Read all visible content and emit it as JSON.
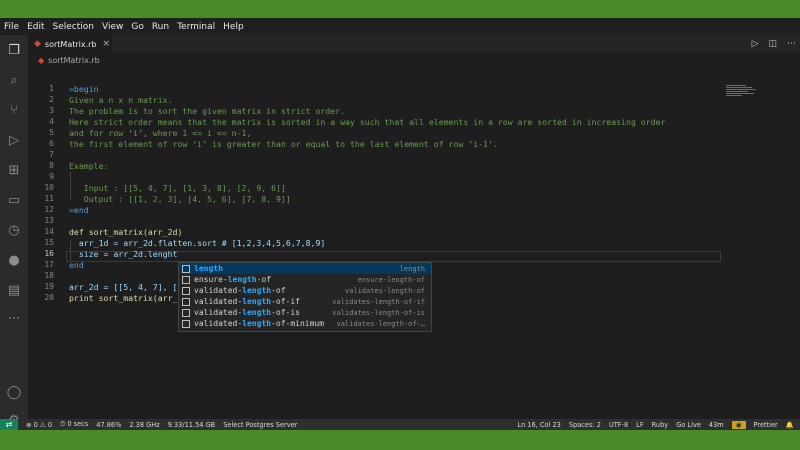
{
  "menu": [
    "File",
    "Edit",
    "Selection",
    "View",
    "Go",
    "Run",
    "Terminal",
    "Help"
  ],
  "tab": {
    "name": "sortMatrix.rb",
    "close": "×"
  },
  "breadcrumb": {
    "file": "sortMatrix.rb"
  },
  "editor": {
    "lines": [
      {
        "n": "1",
        "text": "=begin"
      },
      {
        "n": "2",
        "text": "Given a n x n matrix."
      },
      {
        "n": "3",
        "text": "The problem is to sort the given matrix in strict order."
      },
      {
        "n": "4",
        "text": "Here strict order means that the matrix is sorted in a way such that all elements in a row are sorted in increasing order"
      },
      {
        "n": "5",
        "text": "and for row ‘i’, where 1 <= i <= n-1,"
      },
      {
        "n": "6",
        "text": "the first element of row ‘i’ is greater than or equal to the last element of row ‘i-1’."
      },
      {
        "n": "7",
        "text": ""
      },
      {
        "n": "8",
        "text": "Example:"
      },
      {
        "n": "9",
        "text": ""
      },
      {
        "n": "10",
        "text": "   Input : [[5, 4, 7], [1, 3, 8], [2, 9, 6]]"
      },
      {
        "n": "11",
        "text": "   Output : [[1, 2, 3], [4, 5, 6], [7, 8, 9]]"
      },
      {
        "n": "12",
        "text": "=end"
      },
      {
        "n": "13",
        "text": ""
      },
      {
        "n": "14",
        "text": "def sort_matrix(arr_2d)"
      },
      {
        "n": "15",
        "text": "  arr_1d = arr_2d.flatten.sort # [1,2,3,4,5,6,7,8,9]"
      },
      {
        "n": "16",
        "text": "  size = arr_2d.lenght"
      },
      {
        "n": "17",
        "text": "end"
      },
      {
        "n": "18",
        "text": ""
      },
      {
        "n": "19",
        "text": "arr_2d = [[5, 4, 7], [[1, 3, 8], [2, 9, 6]]"
      },
      {
        "n": "20",
        "text": "print sort_matrix(arr_2d)"
      }
    ]
  },
  "suggestions": [
    {
      "pre": "",
      "match": "length",
      "post": "",
      "detail": "length"
    },
    {
      "pre": "ensure-",
      "match": "length",
      "post": "-of",
      "detail": "ensure-length-of"
    },
    {
      "pre": "validated-",
      "match": "length",
      "post": "-of",
      "detail": "validates-length-of"
    },
    {
      "pre": "validated-",
      "match": "length",
      "post": "-of-if",
      "detail": "validates-length-of-if"
    },
    {
      "pre": "validated-",
      "match": "length",
      "post": "-of-is",
      "detail": "validates-length-of-is"
    },
    {
      "pre": "validated-",
      "match": "length",
      "post": "-of-minimum",
      "detail": "validates-length-of-…"
    }
  ],
  "status": {
    "errors": "⊗ 0 ⚠ 0",
    "time": "⏱ 0 secs",
    "cpu": "47.86%",
    "freq": "2.38 GHz",
    "mem": "9.33/11.54 GB",
    "db": "Select Postgres Server",
    "position": "Ln 16, Col 23",
    "spaces": "Spaces: 2",
    "encoding": "UTF-8",
    "eol": "LF",
    "language": "Ruby",
    "golive": "Go Live",
    "clock": "43m",
    "prettier": "Prettier"
  },
  "colors": {
    "activity_bg": "#2b2b2b",
    "editor_bg": "#1e1e1e",
    "selection": "#04395e",
    "match": "#2aaaff",
    "ruby": "#e0442f"
  }
}
